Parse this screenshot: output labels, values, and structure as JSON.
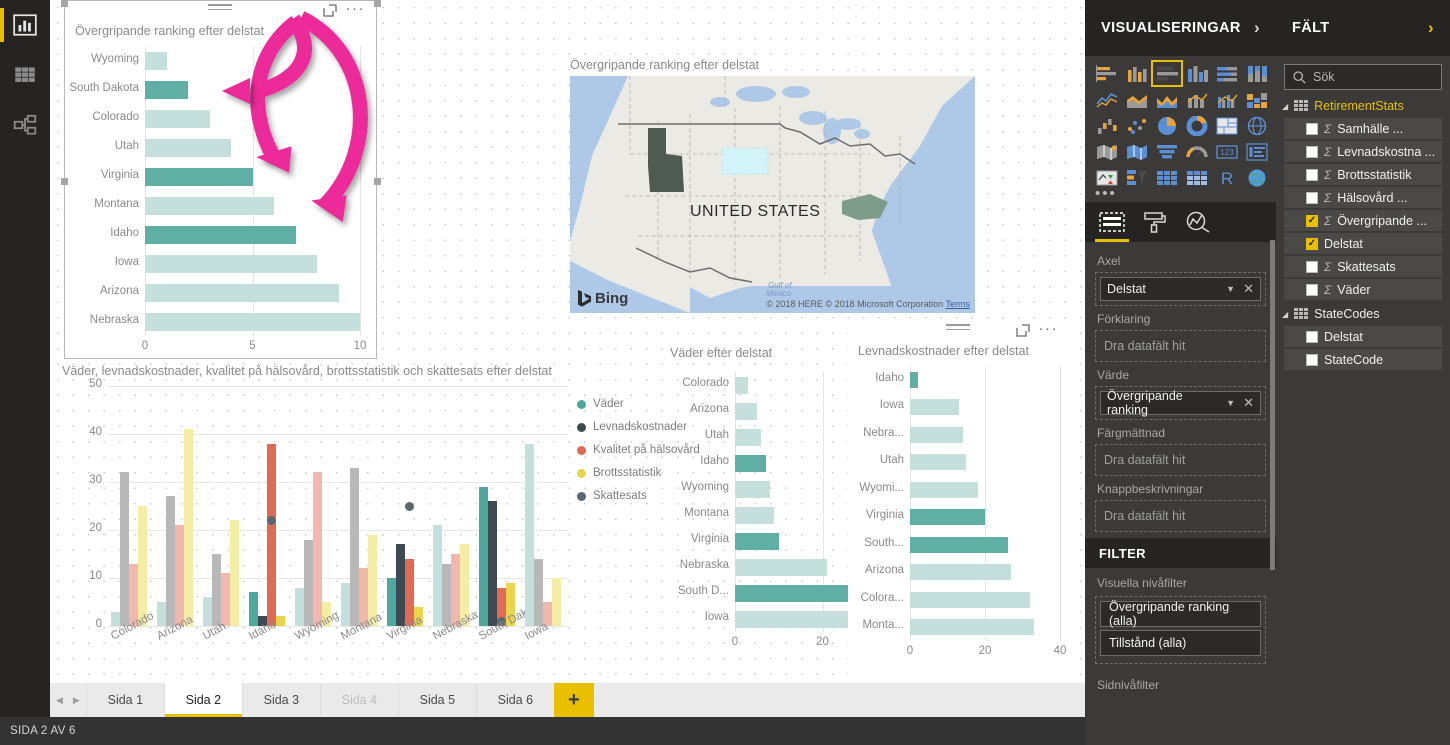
{
  "left_rail": {
    "items": [
      {
        "name": "report-view",
        "icon": "bar-chart-icon",
        "active": true
      },
      {
        "name": "data-view",
        "icon": "table-icon",
        "active": false
      },
      {
        "name": "model-view",
        "icon": "relationships-icon",
        "active": false
      }
    ]
  },
  "visuals": {
    "overall_bar": {
      "title": "Övergripande ranking efter delstat",
      "header": {
        "drag": "drag-handle-icon",
        "focus": "focus-mode-icon",
        "more": "more-options-icon"
      }
    },
    "map": {
      "title": "Övergripande ranking efter delstat",
      "country_label": "UNITED STATES",
      "bing_label": "Bing",
      "credit": "© 2018 HERE © 2018 Microsoft Corporation",
      "terms": "Terms",
      "gulf_label": "Gulf of Mexico"
    },
    "column": {
      "title": "Väder, levnadskostnader, kvalitet på hälsovård, brottsstatistik och skattesats efter delstat"
    },
    "weather_bar": {
      "title": "Väder efter delstat"
    },
    "cost_bar": {
      "title": "Levnadskostnader efter delstat",
      "header": {
        "drag": "drag-handle-icon",
        "focus": "focus-mode-icon",
        "more": "more-options-icon"
      }
    }
  },
  "chart_data": [
    {
      "id": "overall_ranking_bar",
      "type": "bar",
      "title": "Övergripande ranking efter delstat",
      "xlabel": "",
      "ylabel": "",
      "xlim": [
        0,
        10
      ],
      "xticks": [
        "0",
        "5",
        "10"
      ],
      "orientation": "horizontal",
      "grid": true,
      "categories": [
        "Wyoming",
        "South Dakota",
        "Colorado",
        "Utah",
        "Virginia",
        "Montana",
        "Idaho",
        "Iowa",
        "Arizona",
        "Nebraska"
      ],
      "values": [
        1,
        2,
        3,
        4,
        5,
        6,
        7,
        8,
        9,
        10
      ],
      "highlighted": [
        "South Dakota",
        "Virginia",
        "Idaho"
      ],
      "colors": {
        "normal": "#c5e0dc",
        "highlight": "#5fafa5"
      }
    },
    {
      "id": "multi_measure_column",
      "type": "bar",
      "title": "Väder, levnadskostnader, kvalitet på hälsovård, brottsstatistik och skattesats efter delstat",
      "xlabel": "",
      "ylabel": "",
      "ylim": [
        0,
        50
      ],
      "yticks": [
        "0",
        "10",
        "20",
        "30",
        "40",
        "50"
      ],
      "orientation": "vertical",
      "grid": true,
      "legend_position": "right",
      "categories": [
        "Colorado",
        "Arizona",
        "Utah",
        "Idaho",
        "Wyoming",
        "Montana",
        "Virginia",
        "Nebraska",
        "South Dakota",
        "Iowa"
      ],
      "series": [
        {
          "name": "Väder",
          "color": "#4fa89e",
          "dim_color": "#c5e0dc",
          "values": [
            3,
            5,
            6,
            7,
            8,
            9,
            10,
            21,
            29,
            38
          ]
        },
        {
          "name": "Levnadskostnader",
          "color": "#3e4a52",
          "dim_color": "#b8b8b8",
          "values": [
            32,
            27,
            15,
            2,
            18,
            33,
            17,
            13,
            26,
            14
          ]
        },
        {
          "name": "Kvalitet på hälsovård",
          "color": "#e06a56",
          "dim_color": "#f2b8ae",
          "values": [
            13,
            21,
            11,
            38,
            32,
            12,
            14,
            15,
            8,
            5
          ]
        },
        {
          "name": "Brottsstatistik",
          "color": "#e8d44d",
          "dim_color": "#f4eda4",
          "values": [
            25,
            41,
            22,
            2,
            5,
            19,
            4,
            17,
            9,
            10
          ]
        },
        {
          "name": "Skattesats",
          "color": "#5b6670",
          "dim_color": "#8f9aa3",
          "values": [
            null,
            null,
            null,
            22,
            null,
            null,
            25,
            null,
            1,
            null
          ]
        }
      ]
    },
    {
      "id": "weather_by_state_bar",
      "type": "bar",
      "title": "Väder efter delstat",
      "xlim": [
        0,
        40
      ],
      "xticks": [
        "0",
        "20",
        "40"
      ],
      "orientation": "horizontal",
      "grid": true,
      "categories": [
        "Colorado",
        "Arizona",
        "Utah",
        "Idaho",
        "Wyoming",
        "Montana",
        "Virginia",
        "Nebraska",
        "South D...",
        "Iowa"
      ],
      "values": [
        3,
        5,
        6,
        7,
        8,
        9,
        10,
        21,
        29,
        38
      ],
      "highlighted": [
        "Idaho",
        "Virginia",
        "South D..."
      ],
      "colors": {
        "normal": "#c5e0dc",
        "highlight": "#5fafa5"
      }
    },
    {
      "id": "cost_of_living_bar",
      "type": "bar",
      "title": "Levnadskostnader efter delstat",
      "xlim": [
        0,
        40
      ],
      "xticks": [
        "0",
        "20",
        "40"
      ],
      "orientation": "horizontal",
      "grid": true,
      "categories": [
        "Idaho",
        "Iowa",
        "Nebra...",
        "Utah",
        "Wyomi...",
        "Virginia",
        "South...",
        "Arizona",
        "Colora...",
        "Monta..."
      ],
      "values": [
        2,
        13,
        14,
        15,
        18,
        20,
        26,
        27,
        32,
        33
      ],
      "highlighted": [
        "Idaho",
        "Virginia",
        "South..."
      ],
      "colors": {
        "normal": "#c5e0dc",
        "highlight": "#5fafa5"
      }
    }
  ],
  "tabbar": {
    "prev_label": "◀",
    "next_label": "▶",
    "tabs": [
      {
        "label": "Sida 1",
        "state": "normal"
      },
      {
        "label": "Sida 2",
        "state": "active"
      },
      {
        "label": "Sida 3",
        "state": "normal"
      },
      {
        "label": "Sida 4",
        "state": "disabled"
      },
      {
        "label": "Sida 5",
        "state": "normal"
      },
      {
        "label": "Sida 6",
        "state": "normal"
      }
    ],
    "add_label": "+"
  },
  "statusbar": {
    "text": "SIDA 2 AV 6"
  },
  "vis_pane": {
    "title": "VISUALISERINGAR",
    "expand_icon": "chevron-right-icon",
    "icons": [
      {
        "name": "stacked-bar-chart-icon"
      },
      {
        "name": "stacked-column-chart-icon"
      },
      {
        "name": "clustered-bar-chart-icon",
        "selected": true
      },
      {
        "name": "clustered-column-chart-icon"
      },
      {
        "name": "100-stacked-bar-chart-icon"
      },
      {
        "name": "100-stacked-column-chart-icon"
      },
      {
        "name": "line-chart-icon"
      },
      {
        "name": "area-chart-icon"
      },
      {
        "name": "stacked-area-chart-icon"
      },
      {
        "name": "line-stacked-column-chart-icon"
      },
      {
        "name": "line-clustered-column-chart-icon"
      },
      {
        "name": "ribbon-chart-icon"
      },
      {
        "name": "waterfall-chart-icon"
      },
      {
        "name": "scatter-chart-icon"
      },
      {
        "name": "pie-chart-icon"
      },
      {
        "name": "donut-chart-icon"
      },
      {
        "name": "treemap-icon"
      },
      {
        "name": "map-icon"
      },
      {
        "name": "filled-map-icon"
      },
      {
        "name": "shape-map-icon"
      },
      {
        "name": "funnel-chart-icon"
      },
      {
        "name": "gauge-icon"
      },
      {
        "name": "card-icon"
      },
      {
        "name": "multi-row-card-icon"
      },
      {
        "name": "kpi-icon"
      },
      {
        "name": "slicer-icon"
      },
      {
        "name": "table-icon"
      },
      {
        "name": "matrix-icon"
      },
      {
        "name": "r-script-visual-icon"
      },
      {
        "name": "arcgis-maps-icon"
      }
    ],
    "more_icons_label": "•••",
    "tabs": [
      {
        "name": "fields-tab",
        "icon": "fields-pane-icon",
        "active": true
      },
      {
        "name": "format-tab",
        "icon": "paint-roller-icon",
        "active": false
      },
      {
        "name": "analytics-tab",
        "icon": "magnifier-chart-icon",
        "active": false
      }
    ],
    "wells": [
      {
        "label": "Axel",
        "chip": "Delstat",
        "has_chip": true
      },
      {
        "label": "Förklaring",
        "chip": "Dra datafält hit",
        "has_chip": false
      },
      {
        "label": "Värde",
        "chip": "Övergripande ranking",
        "has_chip": true
      },
      {
        "label": "Färgmättnad",
        "chip": "Dra datafält hit",
        "has_chip": false
      },
      {
        "label": "Knappbeskrivningar",
        "chip": "Dra datafält hit",
        "has_chip": false
      }
    ],
    "filter": {
      "title": "FILTER",
      "visual_level_label": "Visuella nivåfilter",
      "filters": [
        "Övergripande ranking (alla)",
        "Tillstånd (alla)"
      ],
      "page_level_label": "Sidnivåfilter"
    }
  },
  "fields_pane": {
    "title": "FÄLT",
    "expand_icon": "chevron-right-icon",
    "search_placeholder": "Sök",
    "search_icon": "search-icon",
    "tables": [
      {
        "name": "RetirementStats",
        "highlighted": true,
        "fields": [
          {
            "label": "Samhälle ...",
            "checked": false,
            "measure": true
          },
          {
            "label": "Levnadskostna ...",
            "checked": false,
            "measure": true
          },
          {
            "label": "Brottsstatistik",
            "checked": false,
            "measure": true
          },
          {
            "label": "Hälsovård ...",
            "checked": false,
            "measure": true
          },
          {
            "label": "Övergripande ...",
            "checked": true,
            "measure": true
          },
          {
            "label": "Delstat",
            "checked": true,
            "measure": false
          },
          {
            "label": "Skattesats",
            "checked": false,
            "measure": true
          },
          {
            "label": "Väder",
            "checked": false,
            "measure": true
          }
        ]
      },
      {
        "name": "StateCodes",
        "highlighted": false,
        "fields": [
          {
            "label": "Delstat",
            "checked": false,
            "measure": false
          },
          {
            "label": "StateCode",
            "checked": false,
            "measure": false
          }
        ]
      }
    ]
  },
  "colors": {
    "accent_yellow": "#e8c000",
    "teal_highlight": "#5fafa5",
    "teal_light": "#c5e0dc",
    "arrow_pink": "#ec2a9a"
  }
}
